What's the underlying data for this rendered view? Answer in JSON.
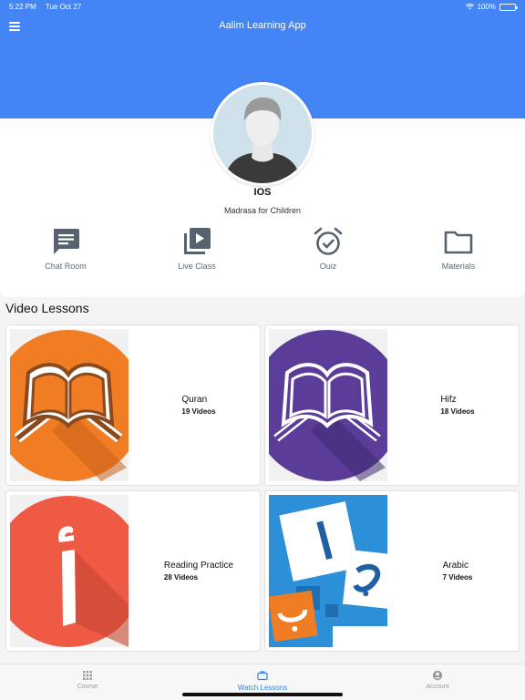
{
  "status_bar": {
    "time": "5:22 PM",
    "date": "Tue Oct 27",
    "battery": "100%"
  },
  "header": {
    "title": "Aalim Learning App",
    "menu_icon": "hamburger-menu-icon"
  },
  "profile": {
    "name": "IOS",
    "subtitle": "Madrasa for Children"
  },
  "quick_actions": [
    {
      "label": "Chat Room",
      "icon": "chat-icon"
    },
    {
      "label": "Live Class",
      "icon": "video-library-icon"
    },
    {
      "label": "Ouiz",
      "icon": "alarm-clock-check-icon"
    },
    {
      "label": "Materials",
      "icon": "folder-icon"
    }
  ],
  "lessons_section": {
    "title": "Video Lessons",
    "items": [
      {
        "title": "Quran",
        "count": "19 Videos",
        "icon": "quran-book-icon",
        "color": "#f07c24"
      },
      {
        "title": "Hifz",
        "count": "18 Videos",
        "icon": "quran-book-icon",
        "color": "#5b3d99"
      },
      {
        "title": "Reading Practice",
        "count": "28 Videos",
        "icon": "arabic-letter-alif-icon",
        "color": "#ee5a44"
      },
      {
        "title": "Arabic",
        "count": "7 Videos",
        "icon": "arabic-letter-tiles-icon",
        "color": "#2d8fd8"
      }
    ]
  },
  "tabbar": {
    "tabs": [
      {
        "label": "Course",
        "icon": "grid-icon"
      },
      {
        "label": "Watch Lessons",
        "icon": "briefcase-icon"
      },
      {
        "label": "Account",
        "icon": "account-circle-icon"
      }
    ],
    "active": "Watch Lessons"
  },
  "colors": {
    "primary": "#4385f5",
    "tab_active": "#2f86e8",
    "icon_gray": "#56636f"
  }
}
